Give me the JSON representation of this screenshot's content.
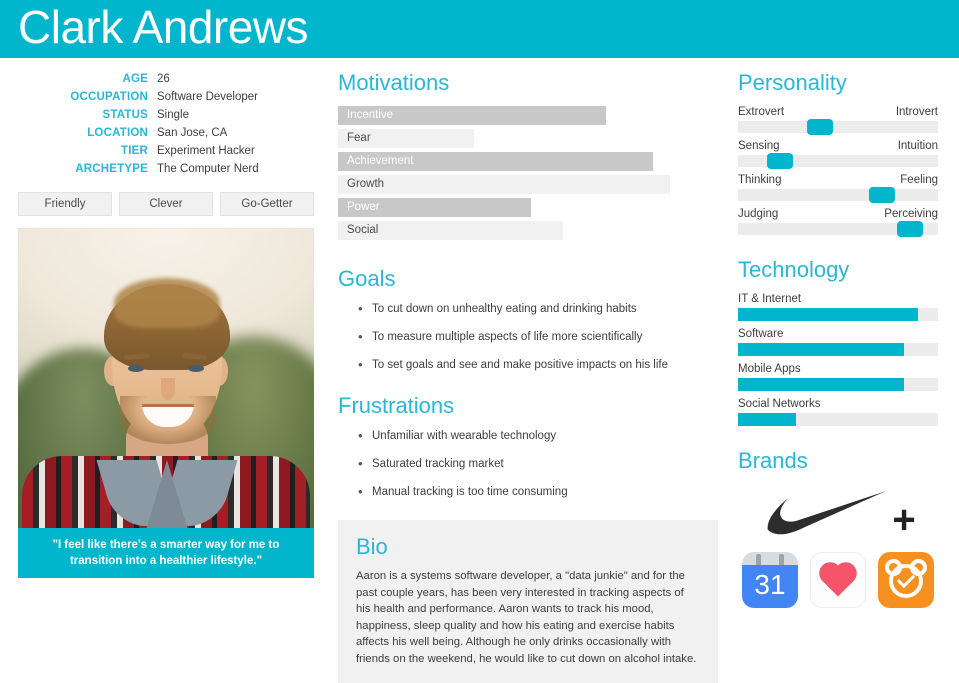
{
  "header": {
    "name": "Clark Andrews",
    "bg_color": "#00b5cc"
  },
  "accent_color": "#29b6d8",
  "info": {
    "rows": [
      {
        "key": "AGE",
        "value": "26"
      },
      {
        "key": "OCCUPATION",
        "value": "Software Developer"
      },
      {
        "key": "STATUS",
        "value": "Single"
      },
      {
        "key": "LOCATION",
        "value": "San Jose, CA"
      },
      {
        "key": "TIER",
        "value": "Experiment Hacker"
      },
      {
        "key": "ARCHETYPE",
        "value": "The Computer Nerd"
      }
    ]
  },
  "traits": [
    "Friendly",
    "Clever",
    "Go-Getter"
  ],
  "photo": {
    "quote": "\"I feel like there's a smarter way for me to transition into a healthier lifestyle.\""
  },
  "motivations": {
    "title": "Motivations",
    "chart_data": {
      "type": "bar",
      "title": "Motivations",
      "categories": [
        "Incentive",
        "Fear",
        "Achievement",
        "Growth",
        "Power",
        "Social"
      ],
      "values": [
        81,
        41,
        95,
        100,
        58,
        68
      ],
      "xlabel": "",
      "ylabel": "",
      "ylim": [
        0,
        100
      ],
      "orientation": "horizontal",
      "grid": false,
      "legend": "none",
      "styles": [
        "dark",
        "light",
        "dark",
        "light",
        "dark",
        "light"
      ]
    }
  },
  "goals": {
    "title": "Goals",
    "items": [
      "To cut down on unhealthy eating and drinking habits",
      "To measure multiple aspects of life more scientifically",
      "To set goals and see and make positive impacts on his life"
    ]
  },
  "frustrations": {
    "title": "Frustrations",
    "items": [
      "Unfamiliar with wearable technology",
      "Saturated tracking market",
      "Manual tracking is too time consuming"
    ]
  },
  "bio": {
    "title": "Bio",
    "text": "Aaron is a systems software developer, a \"data junkie\" and for the past couple years, has been very interested in tracking aspects of his health and performance. Aaron wants to track his mood, happiness, sleep quality and how his eating and exercise habits affects his well being. Although he only drinks occasionally with friends on the weekend, he would like to cut down on alcohol intake."
  },
  "personality": {
    "title": "Personality",
    "chart_data": {
      "type": "bar",
      "title": "Personality",
      "orientation": "horizontal",
      "scale_note": "slider position, 0 = left label, 100 = right label",
      "categories": [
        "Extrovert / Introvert",
        "Sensing / Intuition",
        "Thinking / Feeling",
        "Judging / Perceiving"
      ],
      "values": [
        41,
        21,
        72,
        86
      ],
      "ylim": [
        0,
        100
      ],
      "grid": false,
      "legend": "none"
    },
    "rows": [
      {
        "left": "Extrovert",
        "right": "Introvert",
        "position": 41
      },
      {
        "left": "Sensing",
        "right": "Intuition",
        "position": 21
      },
      {
        "left": "Thinking",
        "right": "Feeling",
        "position": 72
      },
      {
        "left": "Judging",
        "right": "Perceiving",
        "position": 86
      }
    ]
  },
  "technology": {
    "title": "Technology",
    "chart_data": {
      "type": "bar",
      "title": "Technology",
      "orientation": "horizontal",
      "categories": [
        "IT & Internet",
        "Software",
        "Mobile Apps",
        "Social Networks"
      ],
      "values": [
        90,
        83,
        83,
        29
      ],
      "ylim": [
        0,
        100
      ],
      "grid": false,
      "legend": "none",
      "bar_color": "#00b5cc"
    },
    "rows": [
      {
        "label": "IT & Internet",
        "value": 90
      },
      {
        "label": "Software",
        "value": 83
      },
      {
        "label": "Mobile Apps",
        "value": 83
      },
      {
        "label": "Social Networks",
        "value": 29
      }
    ]
  },
  "brands": {
    "title": "Brands",
    "nike_plus": "+",
    "items": [
      {
        "name": "nike-plus-logo"
      },
      {
        "name": "google-calendar-icon",
        "label": "31"
      },
      {
        "name": "apple-health-icon"
      },
      {
        "name": "alarm-clock-app-icon"
      }
    ]
  }
}
